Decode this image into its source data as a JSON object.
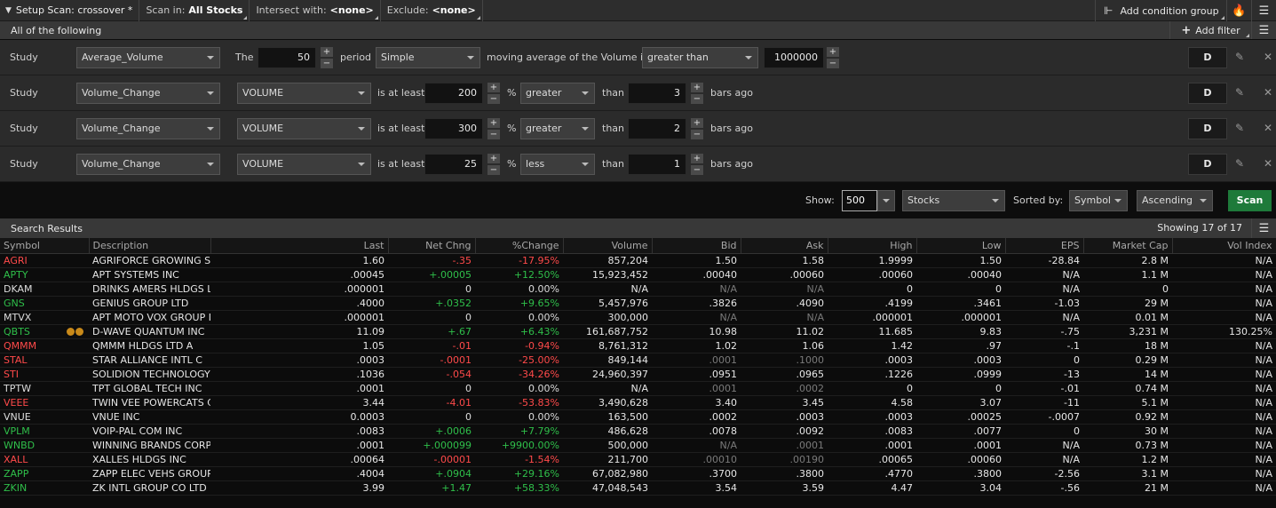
{
  "topbar": {
    "setup_label": "Setup Scan: crossover *",
    "scan_in_prefix": "Scan in:",
    "scan_in_value": "All Stocks",
    "intersect_prefix": "Intersect with:",
    "intersect_value": "<none>",
    "exclude_prefix": "Exclude:",
    "exclude_value": "<none>",
    "add_condition_group": "Add condition group"
  },
  "filters": {
    "header": "All of the following",
    "add_filter": "Add filter",
    "rows": [
      {
        "label": "Study",
        "study": "Average_Volume",
        "the": "The",
        "period_value": "50",
        "period_label": "period",
        "avg_type": "Simple",
        "desc": "moving average of the Volume is",
        "compare": "greater than",
        "threshold": "1000000",
        "d": "D"
      },
      {
        "label": "Study",
        "study": "Volume_Change",
        "field": "VOLUME",
        "atleast": "is at least",
        "pct_value": "200",
        "pct": "%",
        "direction": "greater",
        "than": "than",
        "bars": "3",
        "bars_ago": "bars ago",
        "d": "D"
      },
      {
        "label": "Study",
        "study": "Volume_Change",
        "field": "VOLUME",
        "atleast": "is at least",
        "pct_value": "300",
        "pct": "%",
        "direction": "greater",
        "than": "than",
        "bars": "2",
        "bars_ago": "bars ago",
        "d": "D"
      },
      {
        "label": "Study",
        "study": "Volume_Change",
        "field": "VOLUME",
        "atleast": "is at least",
        "pct_value": "25",
        "pct": "%",
        "direction": "less",
        "than": "than",
        "bars": "1",
        "bars_ago": "bars ago",
        "d": "D"
      }
    ]
  },
  "scan_controls": {
    "show_label": "Show:",
    "show_value": "500",
    "type": "Stocks",
    "sorted_by_label": "Sorted by:",
    "sort_field": "Symbol",
    "sort_order": "Ascending",
    "scan_button": "Scan"
  },
  "results": {
    "title": "Search Results",
    "showing": "Showing 17 of 17",
    "columns": [
      "Symbol",
      "Description",
      "Last",
      "Net Chng",
      "%Change",
      "Volume",
      "Bid",
      "Ask",
      "High",
      "Low",
      "EPS",
      "Market Cap",
      "Vol Index"
    ],
    "rows": [
      {
        "sym": "AGRI",
        "dir": "neg",
        "desc": "AGRIFORCE GROWING SY",
        "last": "1.60",
        "chg": "-.35",
        "pct": "-17.95%",
        "vol": "857,204",
        "bid": "1.50",
        "ask": "1.58",
        "high": "1.9999",
        "low": "1.50",
        "eps": "-28.84",
        "mcap": "2.8 M",
        "vi": "N/A",
        "bidDim": false,
        "askDim": false
      },
      {
        "sym": "APTY",
        "dir": "pos",
        "desc": "APT SYSTEMS INC",
        "last": ".00045",
        "chg": "+.00005",
        "pct": "+12.50%",
        "vol": "15,923,452",
        "bid": ".00040",
        "ask": ".00060",
        "high": ".00060",
        "low": ".00040",
        "eps": "N/A",
        "mcap": "1.1 M",
        "vi": "N/A",
        "bidDim": false,
        "askDim": false
      },
      {
        "sym": "DKAM",
        "dir": "neu",
        "desc": "DRINKS AMERS HLDGS L",
        "last": ".000001",
        "chg": "0",
        "pct": "0.00%",
        "vol": "N/A",
        "bid": "N/A",
        "ask": "N/A",
        "high": "0",
        "low": "0",
        "eps": "N/A",
        "mcap": "0",
        "vi": "N/A",
        "bidDim": true,
        "askDim": true
      },
      {
        "sym": "GNS",
        "dir": "pos",
        "desc": "GENIUS GROUP LTD",
        "last": ".4000",
        "chg": "+.0352",
        "pct": "+9.65%",
        "vol": "5,457,976",
        "bid": ".3826",
        "ask": ".4090",
        "high": ".4199",
        "low": ".3461",
        "eps": "-1.03",
        "mcap": "29 M",
        "vi": "N/A",
        "bidDim": false,
        "askDim": false
      },
      {
        "sym": "MTVX",
        "dir": "neu",
        "desc": "APT MOTO VOX GROUP I",
        "last": ".000001",
        "chg": "0",
        "pct": "0.00%",
        "vol": "300,000",
        "bid": "N/A",
        "ask": "N/A",
        "high": ".000001",
        "low": ".000001",
        "eps": "N/A",
        "mcap": "0.01 M",
        "vi": "N/A",
        "bidDim": true,
        "askDim": true
      },
      {
        "sym": "QBTS",
        "dir": "pos",
        "desc": "D-WAVE QUANTUM INC",
        "last": "11.09",
        "chg": "+.67",
        "pct": "+6.43%",
        "vol": "161,687,752",
        "bid": "10.98",
        "ask": "11.02",
        "high": "11.685",
        "low": "9.83",
        "eps": "-.75",
        "mcap": "3,231 M",
        "vi": "130.25%",
        "bidDim": false,
        "askDim": false,
        "badges": true
      },
      {
        "sym": "QMMM",
        "dir": "neg",
        "desc": "QMMM HLDGS LTD A",
        "last": "1.05",
        "chg": "-.01",
        "pct": "-0.94%",
        "vol": "8,761,312",
        "bid": "1.02",
        "ask": "1.06",
        "high": "1.42",
        "low": ".97",
        "eps": "-.1",
        "mcap": "18 M",
        "vi": "N/A",
        "bidDim": false,
        "askDim": false
      },
      {
        "sym": "STAL",
        "dir": "neg",
        "desc": "STAR ALLIANCE INTL C",
        "last": ".0003",
        "chg": "-.0001",
        "pct": "-25.00%",
        "vol": "849,144",
        "bid": ".0001",
        "ask": ".1000",
        "high": ".0003",
        "low": ".0003",
        "eps": "0",
        "mcap": "0.29 M",
        "vi": "N/A",
        "bidDim": true,
        "askDim": true
      },
      {
        "sym": "STI",
        "dir": "neg",
        "desc": "SOLIDION TECHNOLOGY",
        "last": ".1036",
        "chg": "-.054",
        "pct": "-34.26%",
        "vol": "24,960,397",
        "bid": ".0951",
        "ask": ".0965",
        "high": ".1226",
        "low": ".0999",
        "eps": "-13",
        "mcap": "14 M",
        "vi": "N/A",
        "bidDim": false,
        "askDim": false
      },
      {
        "sym": "TPTW",
        "dir": "neu",
        "desc": "TPT GLOBAL TECH INC",
        "last": ".0001",
        "chg": "0",
        "pct": "0.00%",
        "vol": "N/A",
        "bid": ".0001",
        "ask": ".0002",
        "high": "0",
        "low": "0",
        "eps": "-.01",
        "mcap": "0.74 M",
        "vi": "N/A",
        "bidDim": true,
        "askDim": true
      },
      {
        "sym": "VEEE",
        "dir": "neg",
        "desc": "TWIN VEE POWERCATS C",
        "last": "3.44",
        "chg": "-4.01",
        "pct": "-53.83%",
        "vol": "3,490,628",
        "bid": "3.40",
        "ask": "3.45",
        "high": "4.58",
        "low": "3.07",
        "eps": "-11",
        "mcap": "5.1 M",
        "vi": "N/A",
        "bidDim": false,
        "askDim": false
      },
      {
        "sym": "VNUE",
        "dir": "neu",
        "desc": "VNUE INC",
        "last": "0.0003",
        "chg": "0",
        "pct": "0.00%",
        "vol": "163,500",
        "bid": ".0002",
        "ask": ".0003",
        "high": ".0003",
        "low": ".00025",
        "eps": "-.0007",
        "mcap": "0.92 M",
        "vi": "N/A",
        "bidDim": false,
        "askDim": false
      },
      {
        "sym": "VPLM",
        "dir": "pos",
        "desc": "VOIP-PAL COM INC",
        "last": ".0083",
        "chg": "+.0006",
        "pct": "+7.79%",
        "vol": "486,628",
        "bid": ".0078",
        "ask": ".0092",
        "high": ".0083",
        "low": ".0077",
        "eps": "0",
        "mcap": "30 M",
        "vi": "N/A",
        "bidDim": false,
        "askDim": false
      },
      {
        "sym": "WNBD",
        "dir": "pos",
        "desc": "WINNING BRANDS CORP",
        "last": ".0001",
        "chg": "+.000099",
        "pct": "+9900.00%",
        "vol": "500,000",
        "bid": "N/A",
        "ask": ".0001",
        "high": ".0001",
        "low": ".0001",
        "eps": "N/A",
        "mcap": "0.73 M",
        "vi": "N/A",
        "bidDim": true,
        "askDim": true
      },
      {
        "sym": "XALL",
        "dir": "neg",
        "desc": "XALLES HLDGS INC",
        "last": ".00064",
        "chg": "-.00001",
        "pct": "-1.54%",
        "vol": "211,700",
        "bid": ".00010",
        "ask": ".00190",
        "high": ".00065",
        "low": ".00060",
        "eps": "N/A",
        "mcap": "1.2 M",
        "vi": "N/A",
        "bidDim": true,
        "askDim": true
      },
      {
        "sym": "ZAPP",
        "dir": "pos",
        "desc": "ZAPP ELEC VEHS GROUP",
        "last": ".4004",
        "chg": "+.0904",
        "pct": "+29.16%",
        "vol": "67,082,980",
        "bid": ".3700",
        "ask": ".3800",
        "high": ".4770",
        "low": ".3800",
        "eps": "-2.56",
        "mcap": "3.1 M",
        "vi": "N/A",
        "bidDim": false,
        "askDim": false
      },
      {
        "sym": "ZKIN",
        "dir": "pos",
        "desc": "ZK INTL GROUP CO LTD",
        "last": "3.99",
        "chg": "+1.47",
        "pct": "+58.33%",
        "vol": "47,048,543",
        "bid": "3.54",
        "ask": "3.59",
        "high": "4.47",
        "low": "3.04",
        "eps": "-.56",
        "mcap": "21 M",
        "vi": "N/A",
        "bidDim": false,
        "askDim": false
      }
    ]
  }
}
